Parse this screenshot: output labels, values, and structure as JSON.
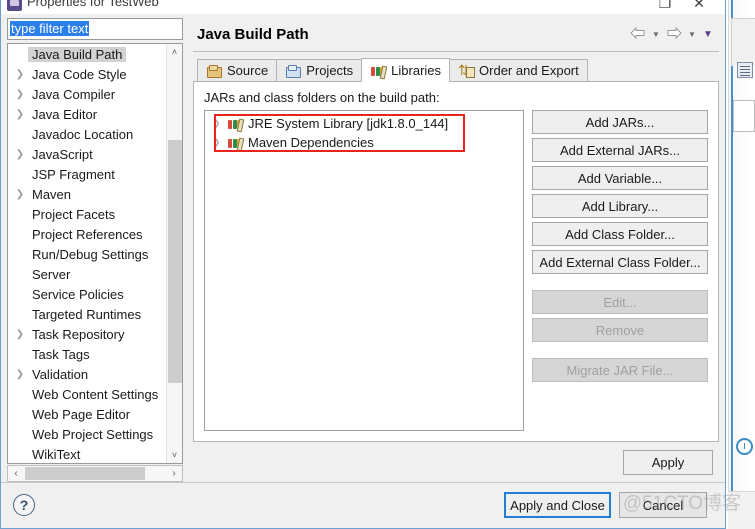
{
  "window": {
    "title": "Properties for TestWeb",
    "icon": "eclipse-properties-icon",
    "maximize_glyph": "❐",
    "close_glyph": "✕"
  },
  "filter": {
    "value": "type filter text",
    "placeholder": "type filter text"
  },
  "tree": {
    "items": [
      {
        "label": "Java Build Path",
        "expandable": false,
        "selected": true
      },
      {
        "label": "Java Code Style",
        "expandable": true,
        "selected": false
      },
      {
        "label": "Java Compiler",
        "expandable": true,
        "selected": false
      },
      {
        "label": "Java Editor",
        "expandable": true,
        "selected": false
      },
      {
        "label": "Javadoc Location",
        "expandable": false,
        "selected": false
      },
      {
        "label": "JavaScript",
        "expandable": true,
        "selected": false
      },
      {
        "label": "JSP Fragment",
        "expandable": false,
        "selected": false
      },
      {
        "label": "Maven",
        "expandable": true,
        "selected": false
      },
      {
        "label": "Project Facets",
        "expandable": false,
        "selected": false
      },
      {
        "label": "Project References",
        "expandable": false,
        "selected": false
      },
      {
        "label": "Run/Debug Settings",
        "expandable": false,
        "selected": false
      },
      {
        "label": "Server",
        "expandable": false,
        "selected": false
      },
      {
        "label": "Service Policies",
        "expandable": false,
        "selected": false
      },
      {
        "label": "Targeted Runtimes",
        "expandable": false,
        "selected": false
      },
      {
        "label": "Task Repository",
        "expandable": true,
        "selected": false
      },
      {
        "label": "Task Tags",
        "expandable": false,
        "selected": false
      },
      {
        "label": "Validation",
        "expandable": true,
        "selected": false
      },
      {
        "label": "Web Content Settings",
        "expandable": false,
        "selected": false
      },
      {
        "label": "Web Page Editor",
        "expandable": false,
        "selected": false
      },
      {
        "label": "Web Project Settings",
        "expandable": false,
        "selected": false
      },
      {
        "label": "WikiText",
        "expandable": false,
        "selected": false
      }
    ],
    "scroll_up_glyph": "˄",
    "scroll_down_glyph": "˅",
    "scroll_left_glyph": "‹",
    "scroll_right_glyph": "›"
  },
  "page": {
    "title": "Java Build Path",
    "nav": {
      "back_icon": "back-arrow-icon",
      "back_caret": "▼",
      "forward_icon": "forward-arrow-icon",
      "forward_caret": "▼",
      "menu_caret": "▼"
    },
    "tabs": [
      {
        "label": "Source",
        "icon": "source-folder-icon",
        "active": false
      },
      {
        "label": "Projects",
        "icon": "projects-folder-icon",
        "active": false
      },
      {
        "label": "Libraries",
        "icon": "libraries-books-icon",
        "active": true
      },
      {
        "label": "Order and Export",
        "icon": "order-export-icon",
        "active": false
      }
    ],
    "libraries": {
      "caption": "JARs and class folders on the build path:",
      "entries": [
        {
          "label": "JRE System Library [jdk1.8.0_144]",
          "icon": "library-books-icon",
          "expandable": true
        },
        {
          "label": "Maven Dependencies",
          "icon": "library-books-icon",
          "expandable": true
        }
      ],
      "annotation_color": "#e8241c",
      "buttons": [
        {
          "label": "Add JARs...",
          "enabled": true,
          "gap_after": false
        },
        {
          "label": "Add External JARs...",
          "enabled": true,
          "gap_after": false
        },
        {
          "label": "Add Variable...",
          "enabled": true,
          "gap_after": false
        },
        {
          "label": "Add Library...",
          "enabled": true,
          "gap_after": false
        },
        {
          "label": "Add Class Folder...",
          "enabled": true,
          "gap_after": false
        },
        {
          "label": "Add External Class Folder...",
          "enabled": true,
          "gap_after": true
        },
        {
          "label": "Edit...",
          "enabled": false,
          "gap_after": false
        },
        {
          "label": "Remove",
          "enabled": false,
          "gap_after": true
        },
        {
          "label": "Migrate JAR File...",
          "enabled": false,
          "gap_after": false
        }
      ]
    },
    "apply_label": "Apply"
  },
  "footer": {
    "help_glyph": "?",
    "apply_and_close_label": "Apply and Close",
    "cancel_label": "Cancel",
    "focus_color": "#1f7fd4"
  },
  "watermark": "@51CTO博客"
}
